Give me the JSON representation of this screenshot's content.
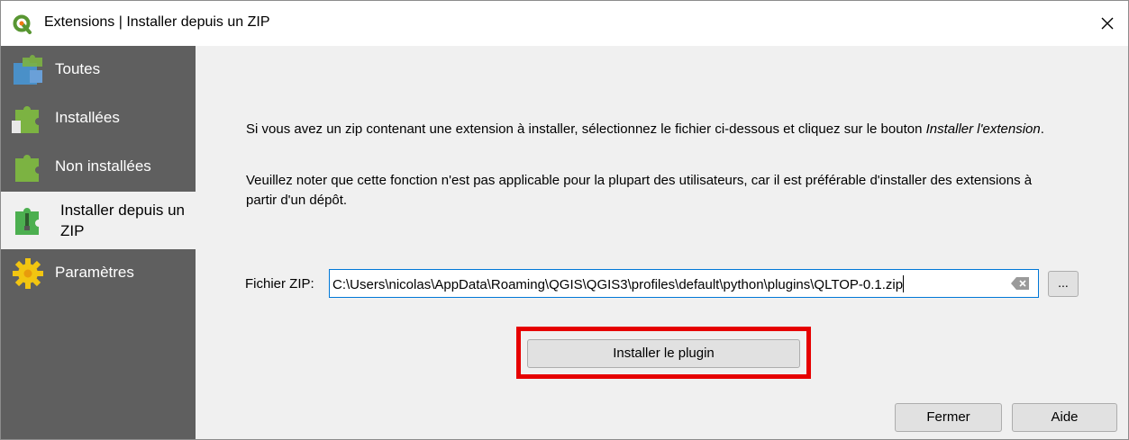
{
  "window": {
    "title": "Extensions | Installer depuis un ZIP"
  },
  "sidebar": {
    "items": [
      {
        "label": "Toutes",
        "icon": "puzzle-all-icon"
      },
      {
        "label": "Installées",
        "icon": "puzzle-installed-icon"
      },
      {
        "label": "Non installées",
        "icon": "puzzle-not-installed-icon"
      },
      {
        "label": "Installer depuis un ZIP",
        "icon": "puzzle-zip-icon",
        "active": true
      },
      {
        "label": "Paramètres",
        "icon": "gear-icon"
      }
    ]
  },
  "main": {
    "intro_text": "Si vous avez un zip contenant une extension à installer, sélectionnez le fichier ci-dessous et cliquez sur le bouton ",
    "intro_em": "Installer l'extension",
    "intro_end": ".",
    "note_text": "Veuillez noter que cette fonction n'est pas applicable pour la plupart des utilisateurs, car il est préférable d'installer des extensions à partir d'un dépôt.",
    "zip_label": "Fichier ZIP:",
    "zip_value": "C:\\Users\\nicolas\\AppData\\Roaming\\QGIS\\QGIS3\\profiles\\default\\python\\plugins\\QLTOP-0.1.zip",
    "browse_label": "...",
    "install_label": "Installer le plugin"
  },
  "footer": {
    "close_label": "Fermer",
    "help_label": "Aide"
  },
  "colors": {
    "sidebar_bg": "#5f5f5f",
    "highlight": "#e60000",
    "focus_border": "#0078d7"
  }
}
